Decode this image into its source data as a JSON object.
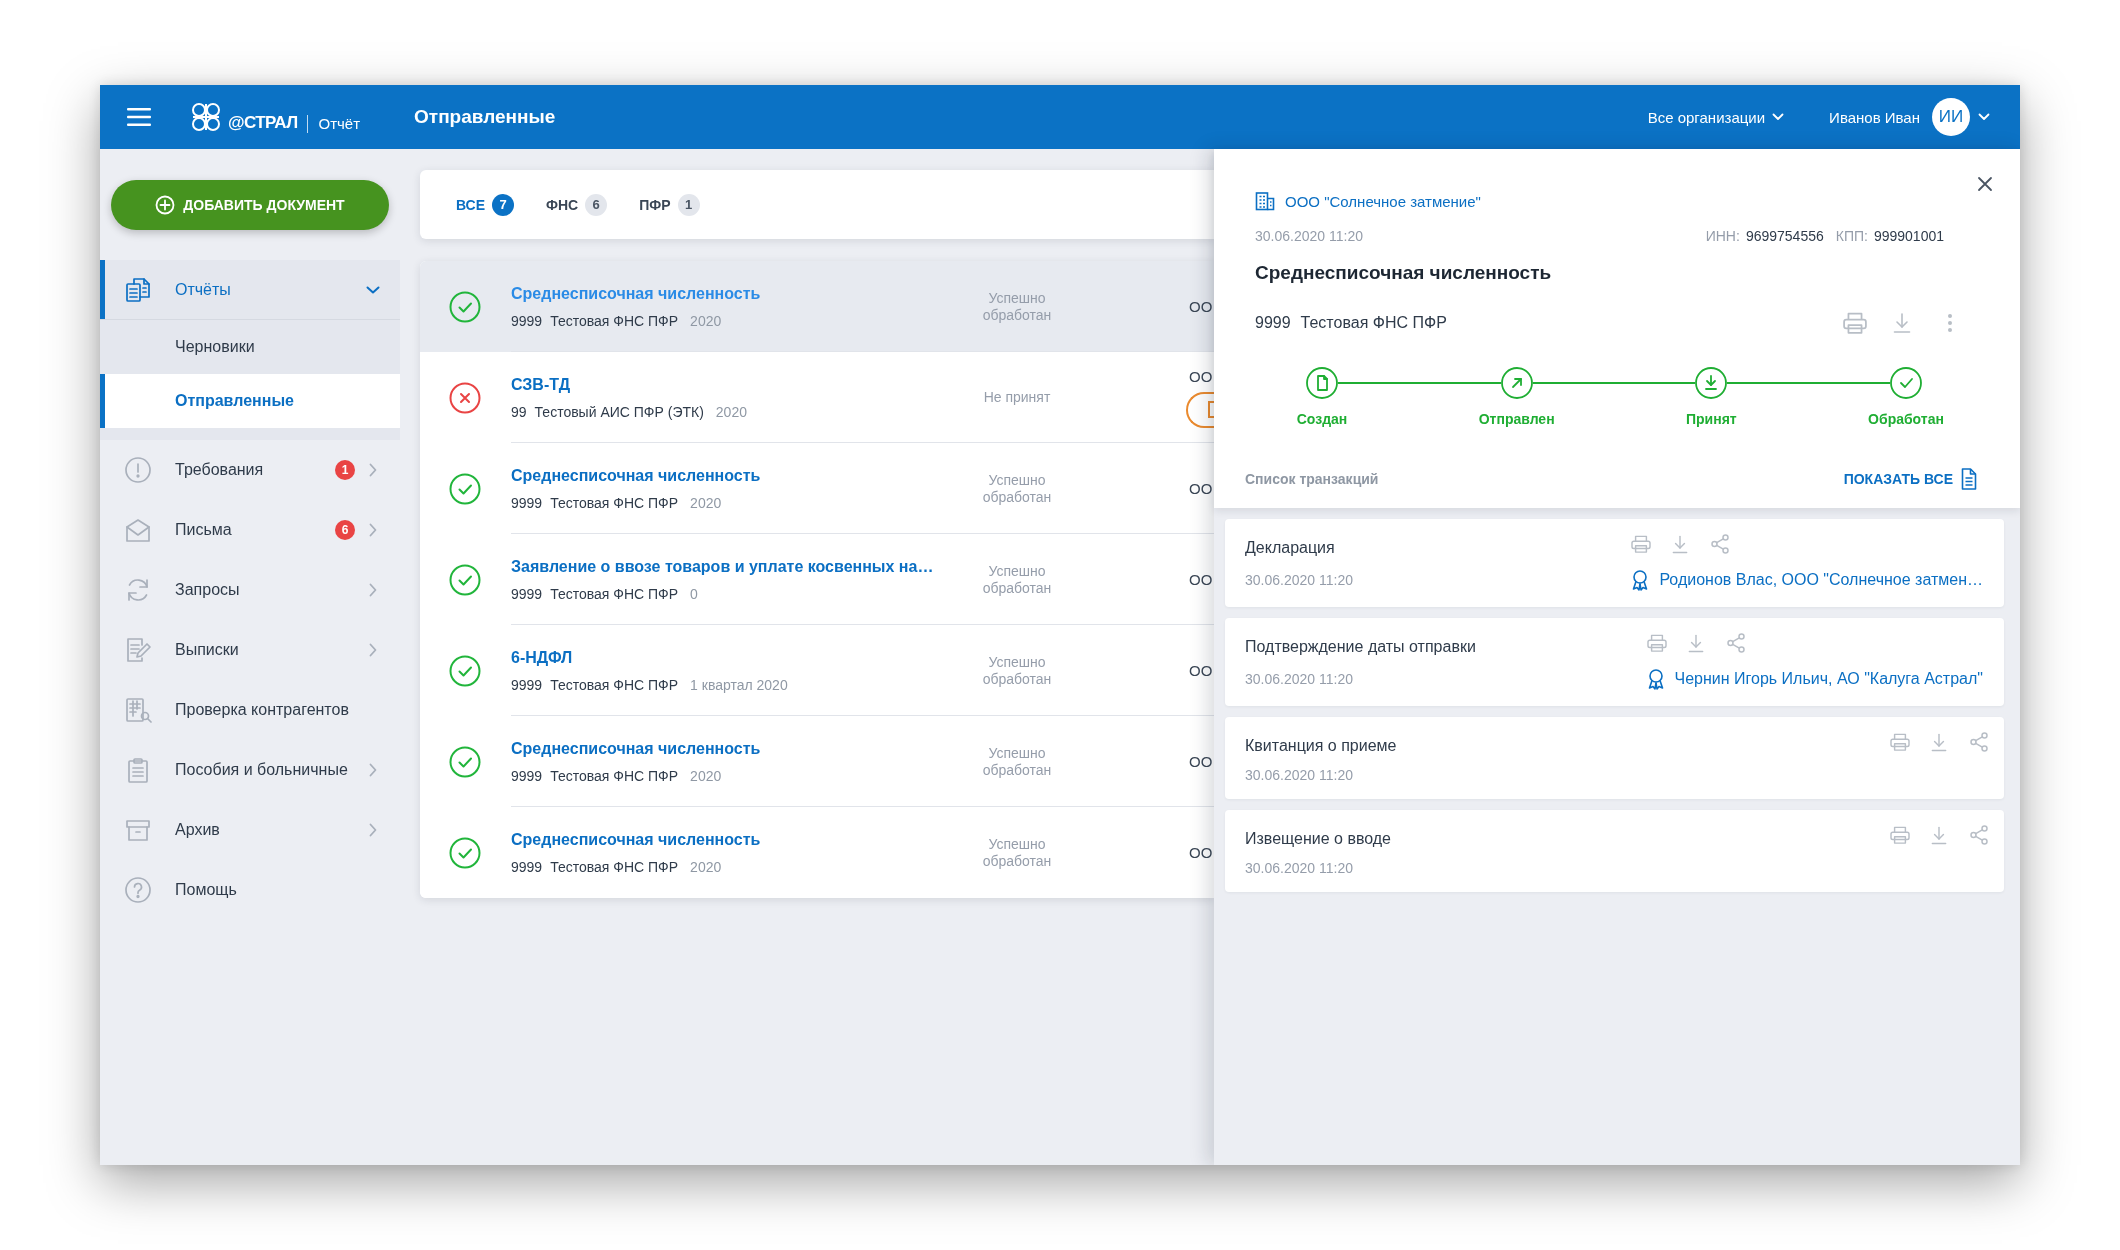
{
  "header": {
    "logo_text": "@СТРАЛ",
    "product": "Отчёт",
    "title": "Отправленные",
    "org_selector": "Все организации",
    "user_name": "Иванов Иван",
    "avatar_initials": "ИИ"
  },
  "sidebar": {
    "add_button": "ДОБАВИТЬ ДОКУМЕНТ",
    "items": [
      {
        "label": "Отчёты",
        "kind": "group",
        "expanded": true,
        "selected": true,
        "children": [
          {
            "label": "Черновики",
            "selected": false
          },
          {
            "label": "Отправленные",
            "selected": true
          }
        ]
      },
      {
        "label": "Требования",
        "kind": "group",
        "expanded": false,
        "selected": false,
        "badge": "1"
      },
      {
        "label": "Письма",
        "kind": "group",
        "expanded": false,
        "selected": false,
        "badge": "6"
      },
      {
        "label": "Запросы",
        "kind": "group",
        "expanded": false,
        "selected": false
      },
      {
        "label": "Выписки",
        "kind": "group",
        "expanded": false,
        "selected": false
      },
      {
        "label": "Проверка контрагентов",
        "kind": "link",
        "selected": false
      },
      {
        "label": "Пособия и больничные",
        "kind": "group",
        "expanded": false,
        "selected": false
      },
      {
        "label": "Архив",
        "kind": "group",
        "expanded": false,
        "selected": false
      },
      {
        "label": "Помощь",
        "kind": "link",
        "selected": false
      }
    ]
  },
  "tabs": [
    {
      "label": "ВСЕ",
      "count": "7",
      "selected": true
    },
    {
      "label": "ФНС",
      "count": "6",
      "selected": false
    },
    {
      "label": "ПФР",
      "count": "1",
      "selected": false
    }
  ],
  "documents": [
    {
      "kind": "success",
      "title": "Среднесписочная численность",
      "code": "9999",
      "recipient": "Тестовая ФНС ПФР",
      "period": "2020",
      "status": "Успешно обработан",
      "column_3": "ОО",
      "action": false,
      "selected": true
    },
    {
      "kind": "error",
      "title": "СЗВ-ТД",
      "code": "99",
      "recipient": "Тестовый АИС ПФР (ЭТК)",
      "period": "2020",
      "status": "Не принят",
      "column_3": "ОО",
      "action": true,
      "selected": false
    },
    {
      "kind": "success",
      "title": "Среднесписочная численность",
      "code": "9999",
      "recipient": "Тестовая ФНС ПФР",
      "period": "2020",
      "status": "Успешно обработан",
      "column_3": "ОО",
      "action": false,
      "selected": false
    },
    {
      "kind": "success",
      "title": "Заявление о ввозе товаров и уплате косвенных на…",
      "code": "9999",
      "recipient": "Тестовая ФНС ПФР",
      "period": "0",
      "status": "Успешно обработан",
      "column_3": "ОО",
      "action": false,
      "selected": false
    },
    {
      "kind": "success",
      "title": "6-НДФЛ",
      "code": "9999",
      "recipient": "Тестовая ФНС ПФР",
      "period": "1 квартал 2020",
      "status": "Успешно обработан",
      "column_3": "ОО",
      "action": false,
      "selected": false
    },
    {
      "kind": "success",
      "title": "Среднесписочная численность",
      "code": "9999",
      "recipient": "Тестовая ФНС ПФР",
      "period": "2020",
      "status": "Успешно обработан",
      "column_3": "ОО",
      "action": false,
      "selected": false
    },
    {
      "kind": "success",
      "title": "Среднесписочная численность",
      "code": "9999",
      "recipient": "Тестовая ФНС ПФР",
      "period": "2020",
      "status": "Успешно обработан",
      "column_3": "ОО",
      "action": false,
      "selected": false
    }
  ],
  "detail": {
    "organization": "ООО \"Солнечное затмение\"",
    "date": "30.06.2020 11:20",
    "inn_label": "ИНН:",
    "inn": "9699754556",
    "kpp_label": "КПП:",
    "kpp": "999901001",
    "title": "Среднесписочная численность",
    "code": "9999",
    "recipient": "Тестовая ФНС ПФР",
    "steps": [
      {
        "label": "Создан",
        "done": true
      },
      {
        "label": "Отправлен",
        "done": true
      },
      {
        "label": "Принят",
        "done": true
      },
      {
        "label": "Обработан",
        "done": true
      }
    ],
    "transactions_label": "Список транзакций",
    "show_all": "ПОКАЗАТЬ ВСЕ",
    "transactions": [
      {
        "title": "Декларация",
        "date": "30.06.2020 11:20",
        "signer": "Родионов Влас, ООО \"Солнечное затмен…"
      },
      {
        "title": "Подтверждение даты отправки",
        "date": "30.06.2020 11:20",
        "signer": "Чернин Игорь Ильич, АО \"Калуга Астрал\""
      },
      {
        "title": "Квитанция о приеме",
        "date": "30.06.2020 11:20"
      },
      {
        "title": "Извещение о вводе",
        "date": "30.06.2020 11:20"
      }
    ]
  }
}
